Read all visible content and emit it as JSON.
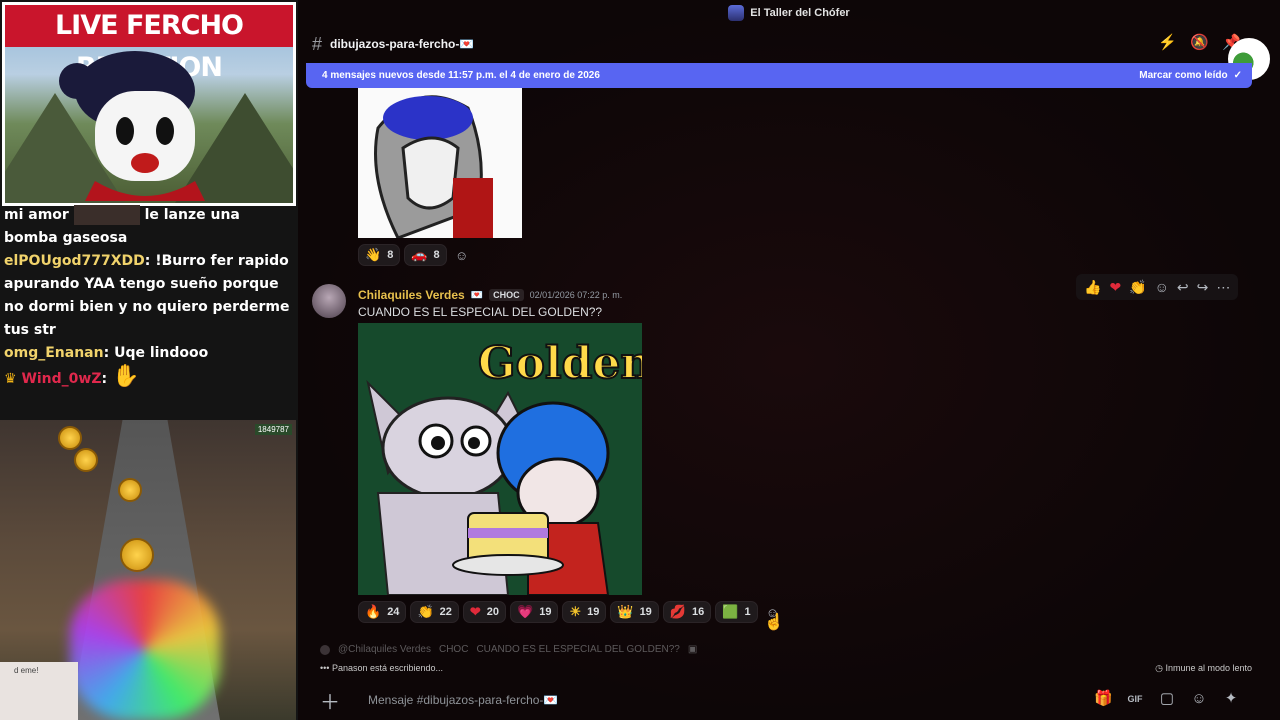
{
  "overlay": {
    "cam_title": "LIVE FERCHO REACTION",
    "chat": [
      {
        "user": "",
        "text_before": "mi amor",
        "text_after": "le lanze una"
      },
      {
        "user": "",
        "text": "bomba gaseosa"
      },
      {
        "user": "elPOUgod777XDD",
        "text": "!Burro fer rapido apurando YAA tengo sueño porque no dormi bien y no quiero perderme tus str"
      },
      {
        "user": "omg_Enanan",
        "text": "Uqe lindooo"
      },
      {
        "user": "Wind_0wZ",
        "text": ""
      }
    ],
    "game_score": "1849787",
    "facecam_text": "d eme!"
  },
  "window": {
    "server_name": "El Taller del Chófer"
  },
  "header": {
    "hash": "#",
    "channel_name": "dibujazos-para-fercho-💌"
  },
  "new_messages_bar": {
    "text": "4 mensajes nuevos desde 11:57 p.m. el 4 de enero de 2026",
    "mark_read": "Marcar como leído"
  },
  "first_message": {
    "reactions": [
      {
        "emoji": "👋",
        "count": "8"
      },
      {
        "emoji": "🚗",
        "count": "8"
      }
    ]
  },
  "message": {
    "author": "Chilaquiles Verdes",
    "author_badge": "💌",
    "tag": "CHOC",
    "timestamp": "02/01/2026 07:22 p. m.",
    "text": "CUANDO ES EL ESPECIAL DEL GOLDEN??",
    "image_title": "Golden",
    "reactions": [
      {
        "emoji": "🔥",
        "count": "24"
      },
      {
        "emoji": "👏",
        "count": "22"
      },
      {
        "emoji": "❤",
        "count": "20"
      },
      {
        "emoji": "💗",
        "count": "19"
      },
      {
        "emoji": "☀",
        "count": "19"
      },
      {
        "emoji": "👑",
        "count": "19"
      },
      {
        "emoji": "💋",
        "count": "16"
      },
      {
        "emoji": "🟩",
        "count": "1"
      }
    ]
  },
  "hover_toolbar": [
    "👍",
    "❤",
    "👏",
    "☺",
    "↩",
    "↪",
    "⋯"
  ],
  "reply_preview": {
    "author": "@Chilaquiles Verdes",
    "tag": "CHOC",
    "text": "CUANDO ES EL ESPECIAL DEL GOLDEN??"
  },
  "typing": "Panason está escribiendo...",
  "slowmode": "Inmune al modo lento",
  "composer": {
    "placeholder": "Mensaje #dibujazos-para-fercho-💌"
  }
}
